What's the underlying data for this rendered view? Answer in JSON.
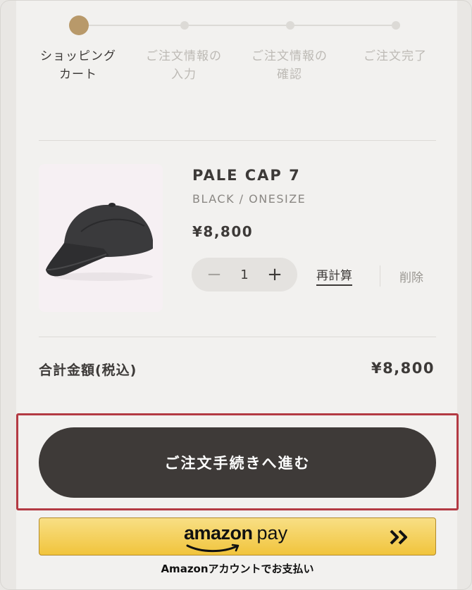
{
  "steps": [
    {
      "label_line1": "ショッピング",
      "label_line2": "カート",
      "active": true
    },
    {
      "label_line1": "ご注文情報の",
      "label_line2": "入力",
      "active": false
    },
    {
      "label_line1": "ご注文情報の",
      "label_line2": "確認",
      "active": false
    },
    {
      "label_line1": "ご注文完了",
      "label_line2": "",
      "active": false
    }
  ],
  "product": {
    "name": "PALE CAP 7",
    "variant": "BLACK / ONESIZE",
    "price": "¥8,800",
    "quantity": "1",
    "minus": "−",
    "plus": "+",
    "recalculate": "再計算",
    "delete": "削除"
  },
  "total": {
    "label": "合計金額(税込)",
    "value": "¥8,800"
  },
  "checkout": {
    "label": "ご注文手続きへ進む"
  },
  "amazon_pay": {
    "word_amazon": "amazon",
    "word_pay": "pay",
    "caption": "Amazonアカウントでお支払い"
  },
  "colors": {
    "accent": "#b8996a",
    "checkout_bg": "#3e3a38",
    "highlight_border": "#b33a43",
    "amazon_yellow": "#f1c43c"
  }
}
